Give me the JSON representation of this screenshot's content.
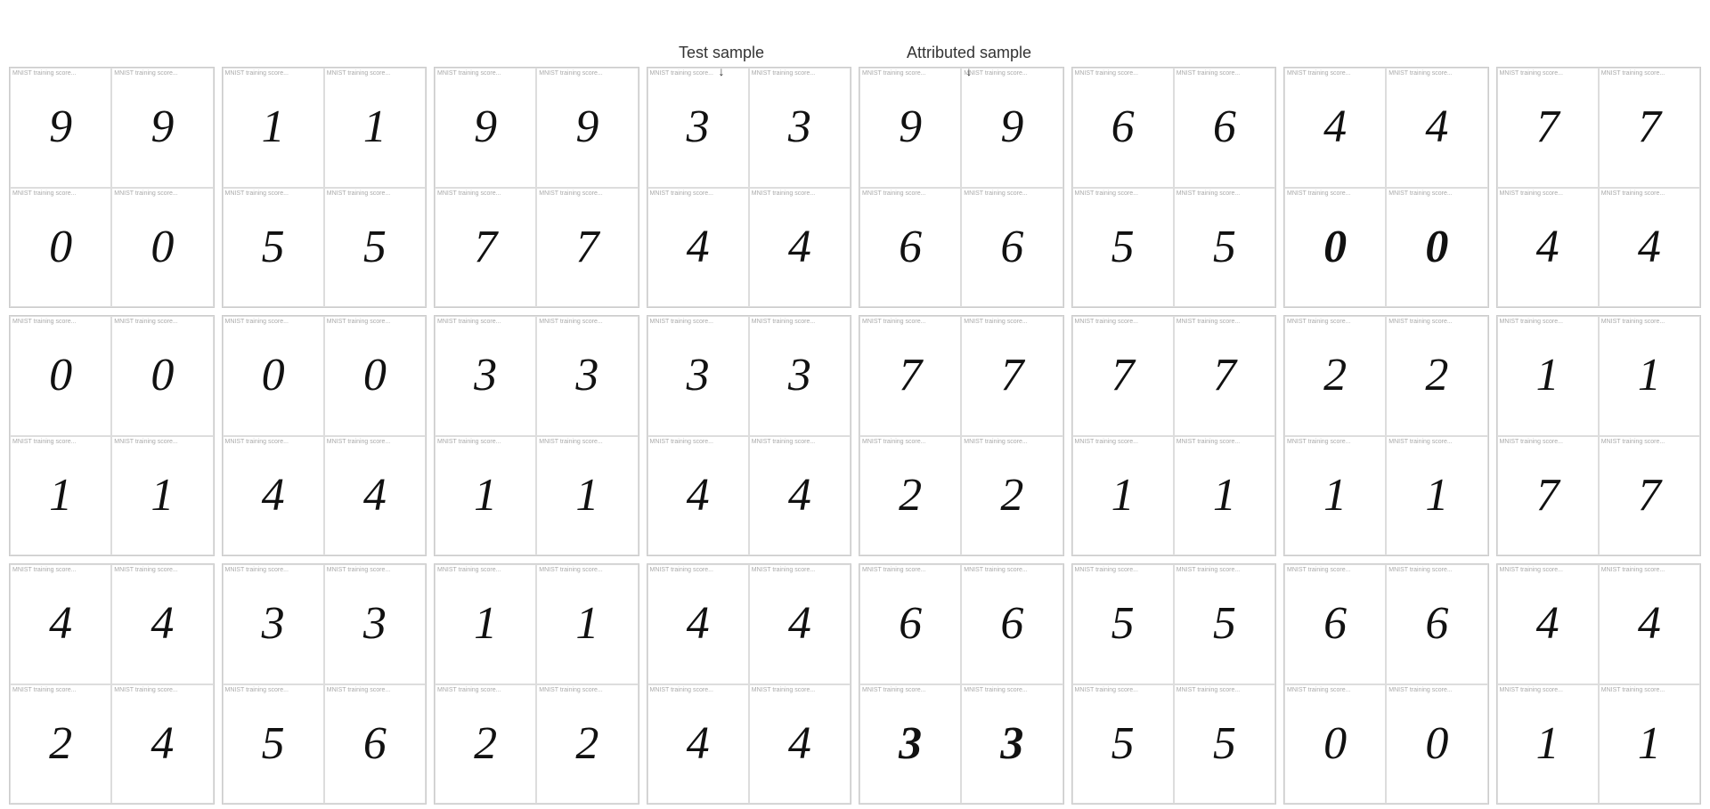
{
  "header": {
    "test_sample_label": "Test sample",
    "attributed_sample_label": "Attributed sample"
  },
  "rows": [
    {
      "groups": [
        {
          "tl": "9",
          "tr": "9",
          "bl": "0",
          "br": "0"
        },
        {
          "tl": "1",
          "tr": "1",
          "bl": "5",
          "br": "5"
        },
        {
          "tl": "9",
          "tr": "9",
          "bl": "7",
          "br": "7",
          "highlight_test": true,
          "highlight_attr": true
        },
        {
          "tl": "3",
          "tr": "3",
          "bl": "4",
          "br": "4"
        },
        {
          "tl": "9",
          "tr": "9",
          "bl": "6",
          "br": "6"
        },
        {
          "tl": "6",
          "tr": "6",
          "bl": "5",
          "br": "5"
        },
        {
          "tl": "4",
          "tr": "4",
          "bl": "0",
          "br": "0",
          "bold_bl": true,
          "bold_br": true
        },
        {
          "tl": "7",
          "tr": "7",
          "bl": "4",
          "br": "4"
        }
      ]
    },
    {
      "groups": [
        {
          "tl": "0",
          "tr": "0",
          "bl": "1",
          "br": "1"
        },
        {
          "tl": "0",
          "tr": "0",
          "bl": "4",
          "br": "4"
        },
        {
          "tl": "3",
          "tr": "3",
          "bl": "1",
          "br": "1"
        },
        {
          "tl": "3",
          "tr": "3",
          "bl": "4",
          "br": "4"
        },
        {
          "tl": "7",
          "tr": "7",
          "bl": "2",
          "br": "2"
        },
        {
          "tl": "7",
          "tr": "7",
          "bl": "1",
          "br": "1"
        },
        {
          "tl": "2",
          "tr": "2",
          "bl": "1",
          "br": "1"
        },
        {
          "tl": "1",
          "tr": "1",
          "bl": "7",
          "br": "7"
        }
      ]
    },
    {
      "groups": [
        {
          "tl": "4",
          "tr": "4",
          "bl": "2",
          "br": "4"
        },
        {
          "tl": "3",
          "tr": "3",
          "bl": "5",
          "br": "6"
        },
        {
          "tl": "1",
          "tr": "1",
          "bl": "2",
          "br": "2"
        },
        {
          "tl": "4",
          "tr": "4",
          "bl": "4",
          "br": "4"
        },
        {
          "tl": "6",
          "tr": "6",
          "bl": "3",
          "br": "3",
          "bold_bl": true,
          "bold_br": true
        },
        {
          "tl": "5",
          "tr": "5",
          "bl": "5",
          "br": "5"
        },
        {
          "tl": "6",
          "tr": "6",
          "bl": "0",
          "br": "0"
        },
        {
          "tl": "4",
          "tr": "4",
          "bl": "1",
          "br": "1"
        }
      ]
    }
  ]
}
